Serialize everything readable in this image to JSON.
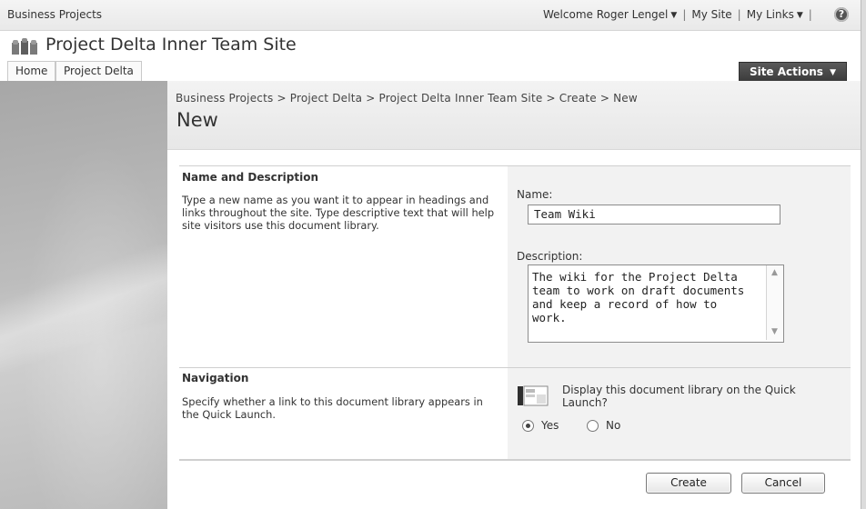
{
  "global_bar": {
    "site_link": "Business Projects",
    "welcome": "Welcome Roger Lengel",
    "my_site": "My Site",
    "my_links": "My Links",
    "separator": "|",
    "help_icon": "?"
  },
  "site": {
    "title": "Project Delta Inner Team Site",
    "logo_icon": "team-site-icon"
  },
  "tabs": [
    {
      "label": "Home"
    },
    {
      "label": "Project Delta"
    }
  ],
  "site_actions": {
    "label": "Site Actions",
    "caret": "▼"
  },
  "page": {
    "breadcrumb": "Business Projects > Project Delta > Project Delta Inner Team Site > Create > New",
    "title": "New"
  },
  "name_section": {
    "title": "Name and Description",
    "description": "Type a new name as you want it to appear in headings and links throughout the site. Type descriptive text that will help site visitors use this document library.",
    "name_label": "Name:",
    "name_value": "Team Wiki",
    "description_label": "Description:",
    "description_value": "The wiki for the Project Delta team to work on draft documents and keep a record of how to work."
  },
  "navigation_section": {
    "title": "Navigation",
    "description": "Specify whether a link to this document library appears in the Quick Launch.",
    "question": "Display this document library on the Quick Launch?",
    "options": [
      {
        "label": "Yes",
        "selected": true
      },
      {
        "label": "No",
        "selected": false
      }
    ]
  },
  "buttons": {
    "create": "Create",
    "cancel": "Cancel"
  },
  "colors": {
    "site_actions_bg": "#4a4a4a",
    "section_panel_bg": "#f2f2f2"
  }
}
